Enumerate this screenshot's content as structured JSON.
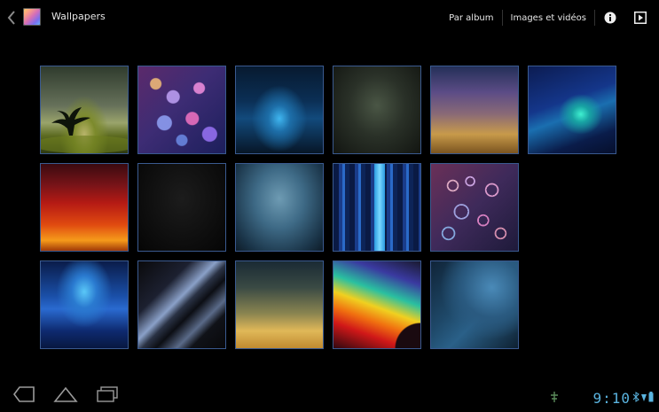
{
  "action_bar": {
    "title": "Wallpapers",
    "menu": {
      "by_album": "Par album",
      "images_videos": "Images et vidéos"
    }
  },
  "icons": {
    "back": "chevron-left-icon",
    "app": "gallery-app-icon",
    "info": "info-icon",
    "slideshow": "play-icon"
  },
  "grid": {
    "rows": [
      [
        "wallpaper-tree-field",
        "wallpaper-bokeh-purple",
        "wallpaper-blue-aurora",
        "wallpaper-dark-grunge",
        "wallpaper-purple-orange-sky",
        "wallpaper-teal-wave"
      ],
      [
        "wallpaper-red-fire",
        "wallpaper-black-texture",
        "wallpaper-blue-mist",
        "wallpaper-blue-stripes",
        "wallpaper-bokeh-rings"
      ],
      [
        "wallpaper-blue-ripple",
        "wallpaper-dark-streaks",
        "wallpaper-golden-haze",
        "wallpaper-rainbow-swirl",
        "wallpaper-blue-curves"
      ]
    ]
  },
  "status": {
    "time": "9:10"
  },
  "colors": {
    "accent": "#5ab4e0",
    "tile_border": "#3a5a90",
    "background": "#000000"
  }
}
